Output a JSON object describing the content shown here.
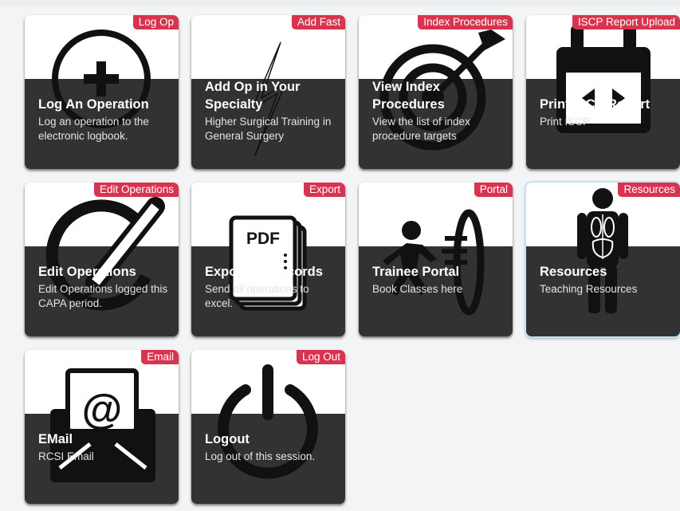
{
  "tiles": [
    {
      "badge": "Log Op",
      "title": "Log An Operation",
      "desc": "Log an operation to the electronic logbook.",
      "icon": "plus-circle-icon"
    },
    {
      "badge": "Add Fast",
      "title": "Add Op in Your Specialty",
      "desc": "Higher Surgical Training in General Surgery",
      "icon": "lightning-icon"
    },
    {
      "badge": "Index Procedures",
      "title": "View Index Procedures",
      "desc": "View the list of index procedure targets",
      "icon": "target-icon"
    },
    {
      "badge": "ISCP Report Upload",
      "title": "Print ISCP Report",
      "desc": "Print ISCP",
      "icon": "calendar-icon"
    },
    {
      "badge": "Edit Operations",
      "title": "Edit Operations",
      "desc": "Edit Operations logged this CAPA period.",
      "icon": "edit-pencil-icon"
    },
    {
      "badge": "Export",
      "title": "Export All Records",
      "desc": "Send all operations to excel.",
      "icon": "pdf-icon",
      "icon_text": "PDF"
    },
    {
      "badge": "Portal",
      "title": "Trainee Portal",
      "desc": "Book Classes here",
      "icon": "portal-icon"
    },
    {
      "badge": "Resources",
      "title": "Resources",
      "desc": "Teaching Resources",
      "icon": "anatomy-icon"
    },
    {
      "badge": "Email",
      "title": "EMail",
      "desc": "RCSI Email",
      "icon": "email-icon",
      "icon_text": "@"
    },
    {
      "badge": "Log Out",
      "title": "Logout",
      "desc": "Log out of this session.",
      "icon": "power-icon"
    }
  ],
  "colors": {
    "badge": "#d9344f",
    "panel": "#323232",
    "highlight": "#bfe3f5"
  }
}
